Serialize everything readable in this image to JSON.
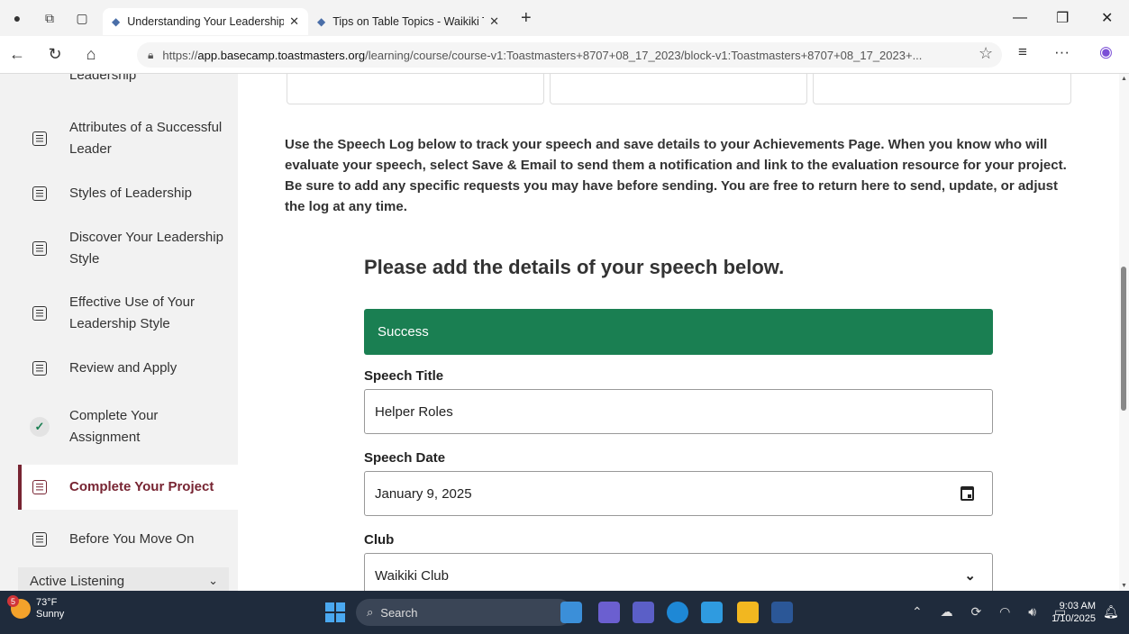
{
  "browser": {
    "tabs": [
      {
        "title": "Understanding Your Leadership St",
        "active": true
      },
      {
        "title": "Tips on Table Topics - Waikiki Toa",
        "active": false
      }
    ],
    "url_host": "app.basecamp.toastmasters.org",
    "url_prefix": "https://",
    "url_path": "/learning/course/course-v1:Toastmasters+8707+08_17_2023/block-v1:Toastmasters+8707+08_17_2023+..."
  },
  "sidebar": {
    "partial_label": "Leadership",
    "items": [
      {
        "label": "Attributes of a Successful Leader",
        "icon": "document-icon"
      },
      {
        "label": "Styles of Leadership",
        "icon": "document-icon"
      },
      {
        "label": "Discover Your Leadership Style",
        "icon": "document-icon"
      },
      {
        "label": "Effective Use of Your Leadership Style",
        "icon": "document-icon"
      },
      {
        "label": "Review and Apply",
        "icon": "document-icon"
      },
      {
        "label": "Complete Your Assignment",
        "icon": "check-icon"
      },
      {
        "label": "Complete Your Project",
        "icon": "document-icon",
        "current": true
      },
      {
        "label": "Before You Move On",
        "icon": "document-icon"
      }
    ],
    "section": "Active Listening"
  },
  "main": {
    "intro": "Use the Speech Log below to track your speech and save details to your Achievements Page. When you know who will evaluate your speech, select Save & Email to send them a notification and link to the evaluation resource for your project. Be sure to add any specific requests you may have before sending. You are free to return here to send, update, or adjust the log at any time.",
    "form_title": "Please add the details of your speech below.",
    "success_message": "Success",
    "fields": {
      "title_label": "Speech Title",
      "title_value": "Helper Roles",
      "date_label": "Speech Date",
      "date_value": "January 9, 2025",
      "club_label": "Club",
      "club_value": "Waikiki Club"
    }
  },
  "taskbar": {
    "weather_temp": "73°F",
    "weather_desc": "Sunny",
    "weather_badge": "5",
    "search_placeholder": "Search",
    "time": "9:03 AM",
    "date": "1/10/2025"
  },
  "colors": {
    "success_green": "#1a7f52",
    "toastmasters_maroon": "#772432"
  }
}
